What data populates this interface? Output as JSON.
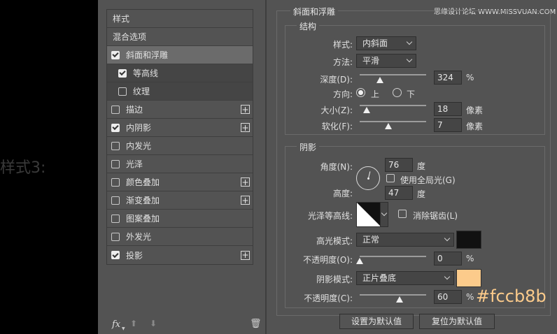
{
  "outside_label": "样式3:",
  "watermark": "思缘设计论坛 WWW.MISSVUAN.COM",
  "styles_list": {
    "items": [
      {
        "label": "样式",
        "type": "header"
      },
      {
        "label": "混合选项",
        "type": "header"
      },
      {
        "label": "斜面和浮雕",
        "checked": true,
        "active": true
      },
      {
        "label": "等高线",
        "checked": true,
        "sub": true
      },
      {
        "label": "纹理",
        "checked": false,
        "sub": true
      },
      {
        "label": "描边",
        "checked": false,
        "plus": true
      },
      {
        "label": "内阴影",
        "checked": true,
        "plus": true
      },
      {
        "label": "内发光",
        "checked": false
      },
      {
        "label": "光泽",
        "checked": false
      },
      {
        "label": "颜色叠加",
        "checked": false,
        "plus": true
      },
      {
        "label": "渐变叠加",
        "checked": false,
        "plus": true
      },
      {
        "label": "图案叠加",
        "checked": false
      },
      {
        "label": "外发光",
        "checked": false
      },
      {
        "label": "投影",
        "checked": true,
        "plus": true
      }
    ],
    "footer": {
      "fx": "fx",
      "up": "⬆",
      "down": "⬇",
      "trash": "🗑"
    }
  },
  "bevel": {
    "title": "斜面和浮雕",
    "structure": {
      "title": "结构",
      "style_label": "样式:",
      "style_value": "内斜面",
      "method_label": "方法:",
      "method_value": "平滑",
      "depth_label": "深度(D):",
      "depth_value": "324",
      "depth_unit": "%",
      "depth_slider": 0.3,
      "direction_label": "方向:",
      "direction_up": "上",
      "direction_down": "下",
      "size_label": "大小(Z):",
      "size_value": "18",
      "size_unit": "像素",
      "size_slider": 0.1,
      "soften_label": "软化(F):",
      "soften_value": "7",
      "soften_unit": "像素",
      "soften_slider": 0.43
    },
    "shading": {
      "title": "阴影",
      "angle_label": "角度(N):",
      "angle_value": "76",
      "angle_unit": "度",
      "global_light_label": "使用全局光(G)",
      "global_light_checked": false,
      "altitude_label": "高度:",
      "altitude_value": "47",
      "altitude_unit": "度",
      "gloss_contour_label": "光泽等高线:",
      "anti_alias_label": "消除锯齿(L)",
      "anti_alias_checked": false,
      "highlight_mode_label": "高光模式:",
      "highlight_mode_value": "正常",
      "highlight_color": "#111111",
      "highlight_opacity_label": "不透明度(O):",
      "highlight_opacity_value": "0",
      "highlight_opacity_unit": "%",
      "highlight_opacity_slider": 0.0,
      "shadow_mode_label": "阴影模式:",
      "shadow_mode_value": "正片叠底",
      "shadow_color": "#fccb8b",
      "shadow_opacity_label": "不透明度(C):",
      "shadow_opacity_value": "60",
      "shadow_opacity_unit": "%",
      "shadow_opacity_slider": 0.6
    },
    "buttons": {
      "make_default": "设置为默认值",
      "reset_default": "复位为默认值"
    }
  },
  "hex_annotation": "#fccb8b"
}
